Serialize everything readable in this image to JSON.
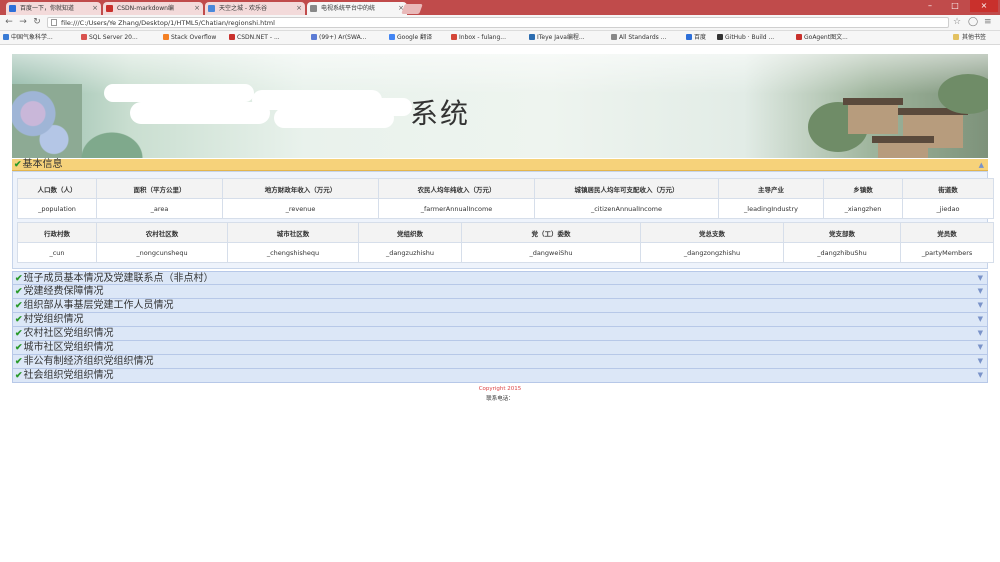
{
  "browser": {
    "tabs": [
      {
        "label": "百度一下，你就知道",
        "active": false,
        "fav": "#2d6fd9"
      },
      {
        "label": "CSDN-markdown编",
        "active": false,
        "fav": "#c9302c"
      },
      {
        "label": "天空之城 - 欢乐谷",
        "active": false,
        "fav": "#4a89dc"
      },
      {
        "label": "电视系统平台中的统",
        "active": true,
        "fav": "#888888"
      }
    ],
    "url": "file:///C:/Users/Ye Zhang/Desktop/1/HTML5/Chatian/regionshi.html",
    "window_controls": {
      "minimize": "–",
      "maximize": "□",
      "close": "×"
    },
    "bookmarks": [
      {
        "label": "中国气象科学...",
        "color": "#3a7bd5"
      },
      {
        "label": "SQL Server 20...",
        "color": "#d9534f"
      },
      {
        "label": "Stack Overflow",
        "color": "#f48024"
      },
      {
        "label": "CSDN.NET - ...",
        "color": "#c9302c"
      },
      {
        "label": "(99+) Ar(SWA...",
        "color": "#5b7bd5"
      },
      {
        "label": "Google 翻译",
        "color": "#4285f4"
      },
      {
        "label": "Inbox - fulang...",
        "color": "#d44638"
      },
      {
        "label": "ITeye Java编程...",
        "color": "#2b6cb0"
      },
      {
        "label": "All Standards ...",
        "color": "#888888"
      },
      {
        "label": "百度",
        "color": "#2d6fd9"
      },
      {
        "label": "GitHub · Build ...",
        "color": "#333333"
      },
      {
        "label": "GoAgent图文...",
        "color": "#c9302c"
      }
    ],
    "other_bookmarks": "其他书签"
  },
  "banner": {
    "title": "系统"
  },
  "basic_info": {
    "header": "基本信息",
    "table_a": {
      "headers": [
        "人口数（人）",
        "面积（平方公里）",
        "地方财政年收入（万元）",
        "农民人均年纯收入（万元）",
        "城镇居民人均年可支配收入（万元）",
        "主导产业",
        "乡镇数",
        "街道数"
      ],
      "values": [
        "_population",
        "_area",
        "_revenue",
        "_farmerAnnualIncome",
        "_citizenAnnualIncome",
        "_leadingIndustry",
        "_xiangzhen",
        "_jiedao"
      ]
    },
    "table_b": {
      "headers": [
        "行政村数",
        "农村社区数",
        "城市社区数",
        "党组织数",
        "党（工）委数",
        "党总支数",
        "党支部数",
        "党员数"
      ],
      "values": [
        "_cun",
        "_nongcunshequ",
        "_chengshishequ",
        "_dangzuzhishu",
        "_dangweiShu",
        "_dangzongzhishu",
        "_dangzhibuShu",
        "_partyMembers"
      ]
    }
  },
  "sections": [
    "班子成员基本情况及党建联系点（非点村）",
    "党建经费保障情况",
    "组织部从事基层党建工作人员情况",
    "村党组织情况",
    "农村社区党组织情况",
    "城市社区党组织情况",
    "非公有制经济组织党组织情况",
    "社会组织党组织情况"
  ],
  "footer": {
    "copyright": "Copyright 2015",
    "contact": "联系电话："
  }
}
